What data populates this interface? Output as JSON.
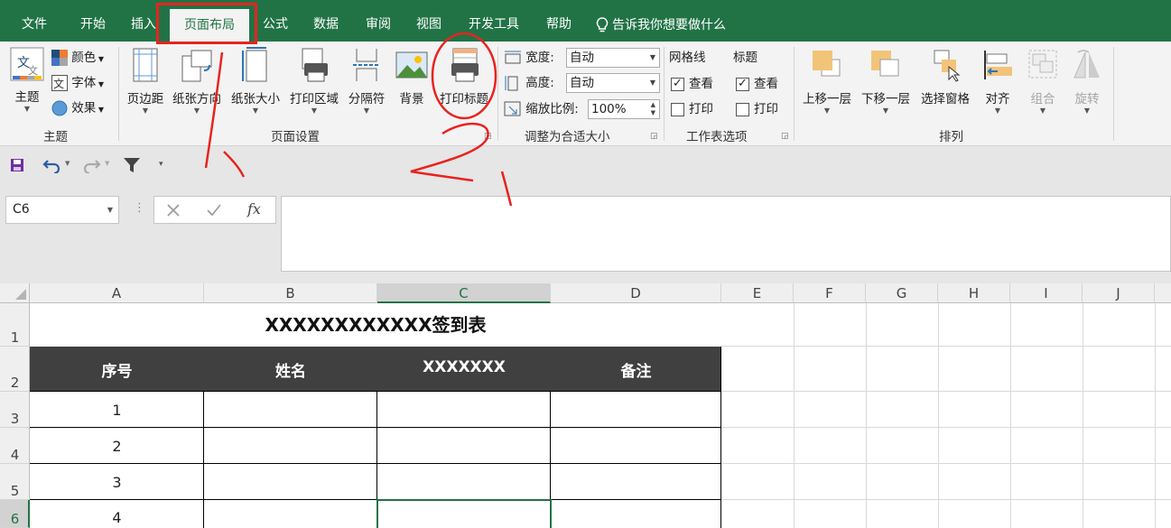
{
  "menu": {
    "tabs": [
      "文件",
      "开始",
      "插入",
      "页面布局",
      "公式",
      "数据",
      "审阅",
      "视图",
      "开发工具",
      "帮助"
    ],
    "tell_me": "告诉我你想要做什么"
  },
  "ribbon": {
    "theme_group": {
      "theme": "主题",
      "colors": "颜色",
      "fonts": "字体",
      "effects": "效果",
      "label": "主题"
    },
    "page_setup_group": {
      "margins": "页边距",
      "orientation": "纸张方向",
      "size": "纸张大小",
      "print_area": "打印区域",
      "breaks": "分隔符",
      "background": "背景",
      "print_titles": "打印标题",
      "label": "页面设置"
    },
    "scale_group": {
      "width_label": "宽度:",
      "width_value": "自动",
      "height_label": "高度:",
      "height_value": "自动",
      "scale_label": "缩放比例:",
      "scale_value": "100%",
      "label": "调整为合适大小"
    },
    "sheet_options_group": {
      "gridlines": "网格线",
      "headings": "标题",
      "view": "查看",
      "print": "打印",
      "label": "工作表选项"
    },
    "arrange_group": {
      "bring_forward": "上移一层",
      "send_backward": "下移一层",
      "selection_pane": "选择窗格",
      "align": "对齐",
      "group": "组合",
      "rotate": "旋转",
      "label": "排列"
    }
  },
  "formula_bar": {
    "name_box": "C6",
    "fx": "fx"
  },
  "sheet": {
    "columns": [
      "A",
      "B",
      "C",
      "D",
      "E",
      "F",
      "G",
      "H",
      "I",
      "J"
    ],
    "rows": [
      "1",
      "2",
      "3",
      "4",
      "5",
      "6"
    ],
    "title": "XXXXXXXXXXXX签到表",
    "headers": [
      "序号",
      "姓名",
      "XXXXXXX",
      "备注"
    ],
    "numbers": [
      "1",
      "2",
      "3",
      "4"
    ],
    "selected_cell": "C6"
  },
  "annotations": {
    "step1": "1",
    "step2": "2"
  },
  "colors": {
    "excel_green": "#217346",
    "header_fill": "#404040",
    "annotation_red": "#e8231f"
  }
}
